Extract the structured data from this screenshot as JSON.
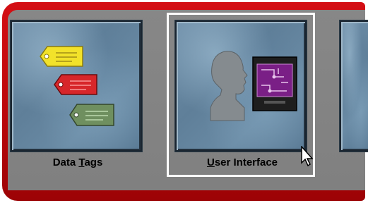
{
  "tiles": [
    {
      "label_before": "Data ",
      "label_hotkey": "T",
      "label_after": "ags",
      "icon": "data-tags-icon"
    },
    {
      "label_before": "",
      "label_hotkey": "U",
      "label_after": "ser Interface",
      "icon": "user-interface-icon",
      "selected": true
    }
  ],
  "tag_colors": [
    "#f2e22a",
    "#d7262a",
    "#6f8f5f"
  ],
  "chip_color": "#7a1f86"
}
